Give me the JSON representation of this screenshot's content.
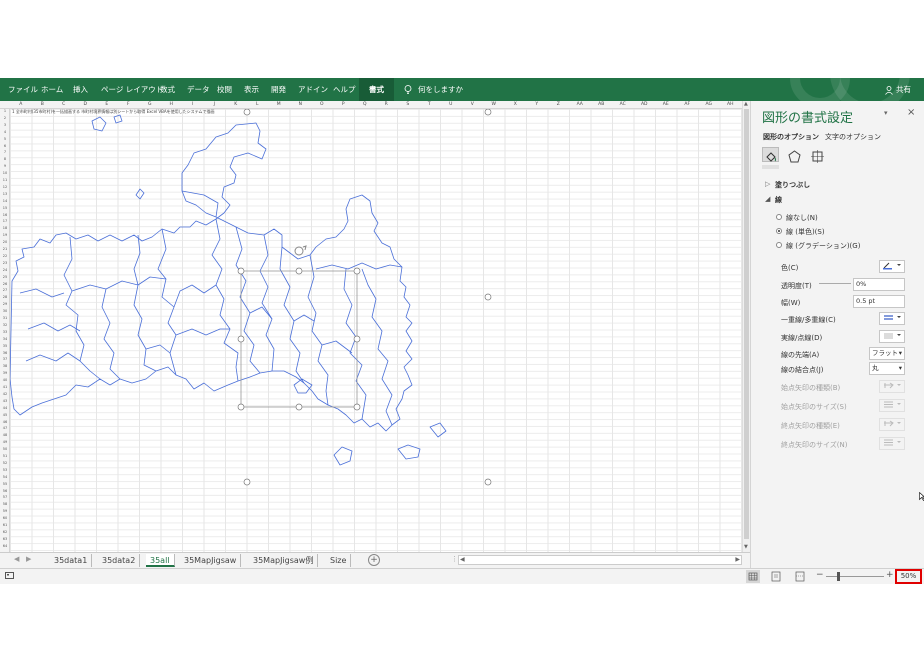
{
  "ribbon": {
    "tabs": [
      "ファイル",
      "ホーム",
      "挿入",
      "ページ レイアウト",
      "数式",
      "データ",
      "校閲",
      "表示",
      "開発",
      "アドイン",
      "ヘルプ"
    ],
    "active_tab": "書式",
    "tell_me": "何をしますか",
    "share": "共有"
  },
  "sheet": {
    "columns": [
      "A",
      "B",
      "C",
      "D",
      "E",
      "F",
      "G",
      "H",
      "I",
      "J",
      "K",
      "L",
      "M",
      "N",
      "O",
      "P",
      "Q",
      "R",
      "S",
      "T",
      "U",
      "V",
      "W",
      "X",
      "Y",
      "Z",
      "AA",
      "AB",
      "AC",
      "AD",
      "AE",
      "AF",
      "AG",
      "AH",
      "A"
    ],
    "a1_note": "1 全市町村(35市町村)を一括描画する 市町村境界情報は別シートから取得 Excel VBAを使用したシステムで描画"
  },
  "sheet_tabs": [
    "35data1",
    "35data2",
    "35all",
    "35MapJigsaw",
    "35MapJigsaw例",
    "Size"
  ],
  "active_sheet": "35all",
  "status": {
    "zoom": "50%"
  },
  "format_pane": {
    "title": "図形の書式設定",
    "tab_shape": "図形のオプション",
    "tab_text": "文字のオプション",
    "fill_section": "塗りつぶし",
    "line_section": "線",
    "line_none": "線なし(N)",
    "line_solid": "線 (単色)(S)",
    "line_gradient": "線 (グラデーション)(G)",
    "color": "色(C)",
    "transparency": "透明度(T)",
    "transparency_value": "0%",
    "width": "幅(W)",
    "width_value": "0.5 pt",
    "compound": "一重線/多重線(C)",
    "dash": "実線/点線(D)",
    "cap": "線の先端(A)",
    "cap_value": "フラット",
    "join": "線の結合点(J)",
    "join_value": "丸",
    "begin_arrow_type": "始点矢印の種類(B)",
    "begin_arrow_size": "始点矢印のサイズ(S)",
    "end_arrow_type": "終点矢印の種類(E)",
    "end_arrow_size": "終点矢印のサイズ(N)"
  },
  "colors": {
    "ribbon": "#217346",
    "map_line": "#4a6fd8",
    "zoom_highlight": "#e00000"
  }
}
